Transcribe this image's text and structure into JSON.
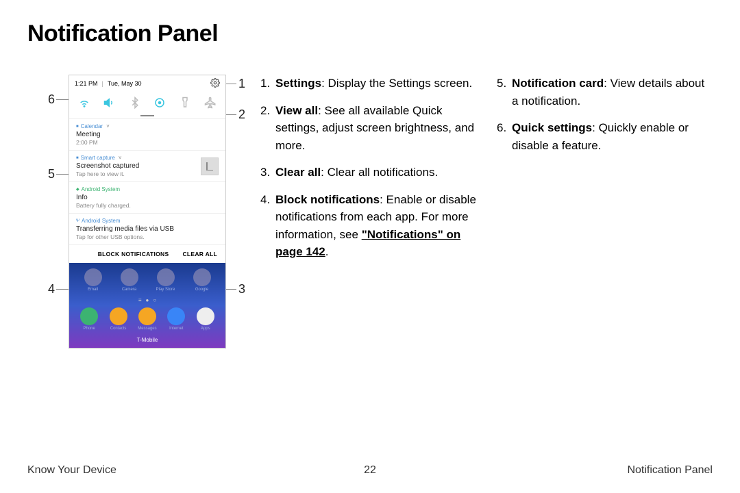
{
  "title": "Notification Panel",
  "footer": {
    "left": "Know Your Device",
    "center": "22",
    "right": "Notification Panel"
  },
  "phone": {
    "time": "1:21 PM",
    "date": "Tue, May 30",
    "qs_icons": [
      "wifi",
      "sound",
      "bluetooth",
      "location",
      "flashlight",
      "airplane"
    ],
    "notifs": {
      "calendar": {
        "app": "Calendar",
        "title": "Meeting",
        "sub": "2:00 PM"
      },
      "capture": {
        "app": "Smart capture",
        "title": "Screenshot captured",
        "sub": "Tap here to view it."
      },
      "system1": {
        "app": "Android System",
        "title": "Info",
        "sub": "Battery fully charged."
      },
      "system2": {
        "app": "Android System",
        "title": "Transferring media files via USB",
        "sub": "Tap for other USB options."
      }
    },
    "actions": {
      "block": "BLOCK NOTIFICATIONS",
      "clear": "CLEAR ALL"
    },
    "home_row1": [
      "Email",
      "Camera",
      "Play Store",
      "Google"
    ],
    "dock": [
      "Phone",
      "Contacts",
      "Messages",
      "Internet",
      "Apps"
    ],
    "carrier": "T-Mobile"
  },
  "callouts": {
    "c1": "1",
    "c2": "2",
    "c3": "3",
    "c4": "4",
    "c5": "5",
    "c6": "6"
  },
  "desc": {
    "i1": {
      "n": "1.",
      "b": "Settings",
      "t": ": Display the Settings screen."
    },
    "i2": {
      "n": "2.",
      "b": "View all",
      "t": ": See all available Quick settings, adjust screen brightness, and more."
    },
    "i3": {
      "n": "3.",
      "b": "Clear all",
      "t": ": Clear all notifications."
    },
    "i4": {
      "n": "4.",
      "b": "Block notifications",
      "t": ": Enable or disable notifications from each app. For more information, see ",
      "x": "\"Notifications\" on page 142",
      "t2": "."
    },
    "i5": {
      "n": "5.",
      "b": "Notification card",
      "t": ": View details about a notification."
    },
    "i6": {
      "n": "6.",
      "b": "Quick settings",
      "t": ": Quickly enable or disable a feature."
    }
  }
}
